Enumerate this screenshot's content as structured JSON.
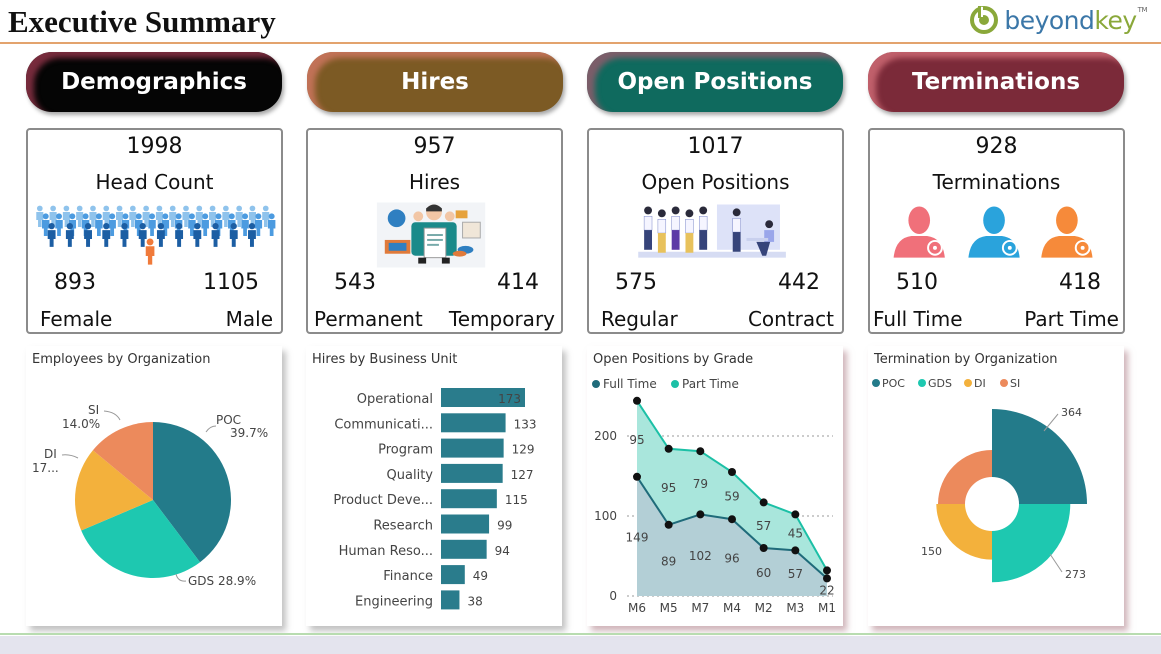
{
  "header": {
    "title": "Executive Summary",
    "logo": {
      "name": "beyondkey",
      "part1": "beyond",
      "part2": "key",
      "tm": "TM"
    }
  },
  "nav": [
    {
      "label": "Demographics",
      "color": "#050505"
    },
    {
      "label": "Hires",
      "color": "#7c5a24"
    },
    {
      "label": "Open Positions",
      "color": "#0f6a5e"
    },
    {
      "label": "Terminations",
      "color": "#7b2a39"
    }
  ],
  "kpis": {
    "demographics": {
      "total": "1998",
      "label": "Head Count",
      "left_value": "893",
      "left_label": "Female",
      "right_value": "1105",
      "right_label": "Male"
    },
    "hires": {
      "total": "957",
      "label": "Hires",
      "left_value": "543",
      "left_label": "Permanent",
      "right_value": "414",
      "right_label": "Temporary"
    },
    "open_positions": {
      "total": "1017",
      "label": "Open Positions",
      "left_value": "575",
      "left_label": "Regular",
      "right_value": "442",
      "right_label": "Contract"
    },
    "terminations": {
      "total": "928",
      "label": "Terminations",
      "left_value": "510",
      "left_label": "Full Time",
      "right_value": "418",
      "right_label": "Part Time"
    }
  },
  "colors": {
    "poc": "#237b8a",
    "gds": "#1ec8b0",
    "di": "#f3b13c",
    "si": "#ec8a5c",
    "bar": "#2a7c8c",
    "full_time": "#1f6b7a",
    "part_time": "#1cc0a6"
  },
  "chart_data": [
    {
      "type": "pie",
      "title": "Employees by Organization",
      "categories": [
        "POC",
        "GDS",
        "DI",
        "SI"
      ],
      "values": [
        39.7,
        28.9,
        17.4,
        14.0
      ],
      "labels": [
        "POC\n39.7%",
        "GDS 28.9%",
        "DI\n17...",
        "SI\n14.0%"
      ],
      "unit": "%"
    },
    {
      "type": "bar",
      "title": "Hires by Business Unit",
      "orientation": "horizontal",
      "categories": [
        "Operational",
        "Communicati...",
        "Program",
        "Quality",
        "Product Deve...",
        "Research",
        "Human Reso...",
        "Finance",
        "Engineering"
      ],
      "values": [
        173,
        133,
        129,
        127,
        115,
        99,
        94,
        49,
        38
      ]
    },
    {
      "type": "area",
      "stacked": true,
      "title": "Open Positions by Grade",
      "legend": [
        "Full Time",
        "Part Time"
      ],
      "legend_position": "top-left",
      "x": [
        "M6",
        "M5",
        "M7",
        "M4",
        "M2",
        "M3",
        "M1"
      ],
      "series": [
        {
          "name": "Full Time",
          "values": [
            149,
            89,
            102,
            96,
            60,
            57,
            22
          ]
        },
        {
          "name": "Part Time",
          "values": [
            95,
            95,
            79,
            59,
            57,
            45,
            10
          ]
        }
      ],
      "yticks": [
        0,
        100,
        200
      ],
      "ylim": [
        0,
        250
      ],
      "grid": true
    },
    {
      "type": "pie",
      "variant": "rose-donut",
      "title": "Termination by Organization",
      "legend": [
        "POC",
        "GDS",
        "DI",
        "SI"
      ],
      "legend_position": "top-left",
      "categories": [
        "POC",
        "GDS",
        "DI",
        "SI"
      ],
      "values": [
        364,
        273,
        150,
        141
      ]
    }
  ]
}
